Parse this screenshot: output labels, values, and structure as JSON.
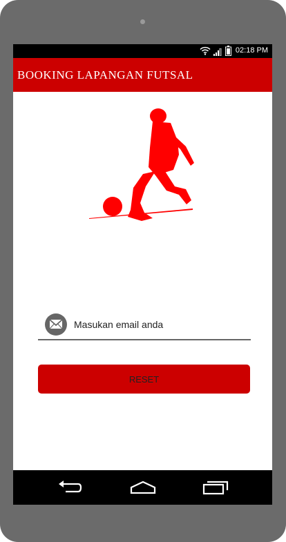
{
  "status_bar": {
    "time": "02:18 PM"
  },
  "app_bar": {
    "title": "BOOKING LAPANGAN FUTSAL"
  },
  "form": {
    "email_placeholder": "Masukan email anda",
    "reset_label": "RESET"
  },
  "icons": {
    "wifi": "wifi-icon",
    "signal": "signal-icon",
    "battery": "battery-icon",
    "mail": "envelope-icon",
    "back": "back-icon",
    "home": "home-icon",
    "recents": "recents-icon"
  },
  "colors": {
    "accent": "#cc0000",
    "device": "#6b6b6b",
    "bars": "#000000"
  }
}
